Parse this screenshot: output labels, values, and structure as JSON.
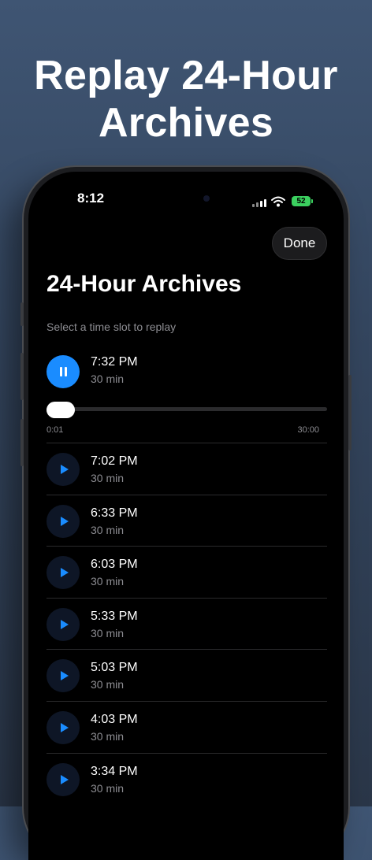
{
  "headline": "Replay 24-Hour Archives",
  "status_bar": {
    "time": "8:12",
    "battery": "52"
  },
  "header": {
    "done_label": "Done",
    "title": "24-Hour Archives",
    "subtitle": "Select a time slot to replay"
  },
  "now_playing": {
    "time": "7:32 PM",
    "duration": "30 min",
    "elapsed_label": "0:01",
    "total_label": "30:00",
    "progress_fraction": 0.0
  },
  "slots": [
    {
      "time": "7:02 PM",
      "duration": "30 min"
    },
    {
      "time": "6:33 PM",
      "duration": "30 min"
    },
    {
      "time": "6:03 PM",
      "duration": "30 min"
    },
    {
      "time": "5:33 PM",
      "duration": "30 min"
    },
    {
      "time": "5:03 PM",
      "duration": "30 min"
    },
    {
      "time": "4:03 PM",
      "duration": "30 min"
    },
    {
      "time": "3:34 PM",
      "duration": "30 min"
    }
  ],
  "colors": {
    "accent": "#1a8cff",
    "battery": "#3bd05f",
    "background": "#000000"
  },
  "icons": {
    "pause": "pause-icon",
    "play": "play-icon",
    "wifi": "wifi-icon",
    "signal": "cellular-signal-icon",
    "battery": "battery-icon"
  }
}
